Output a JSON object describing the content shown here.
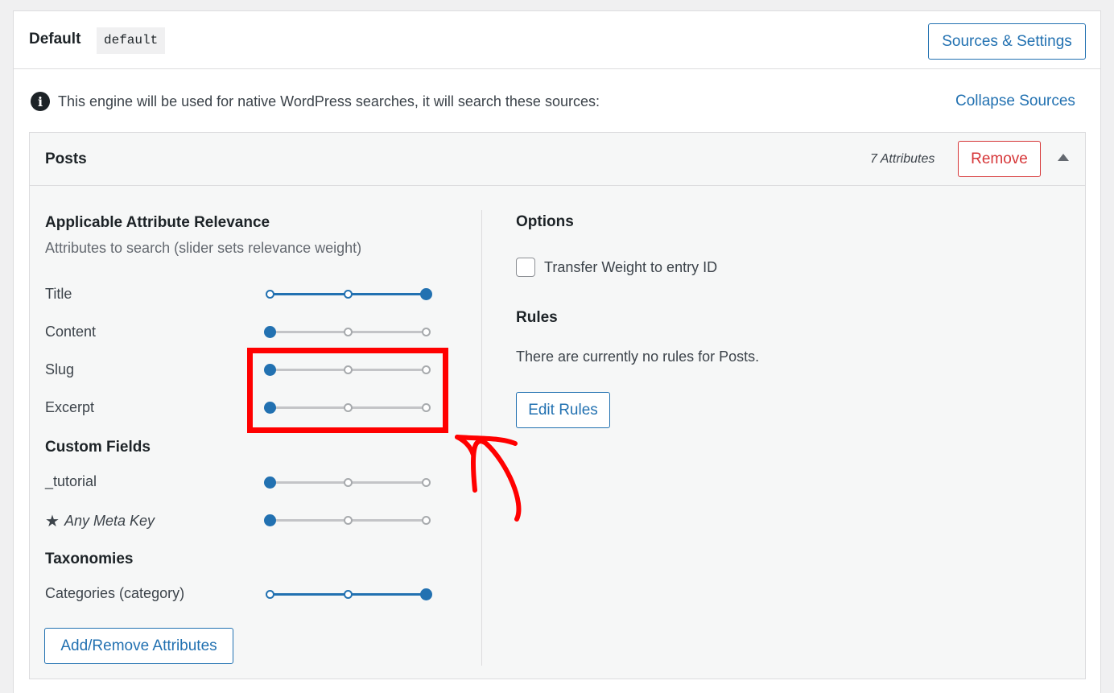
{
  "engine": {
    "title": "Default",
    "slug": "default",
    "sources_settings_label": "Sources & Settings"
  },
  "notice": {
    "icon": "info-icon",
    "text": "This engine will be used for native WordPress searches, it will search these sources:",
    "collapse_label": "Collapse Sources"
  },
  "source": {
    "title": "Posts",
    "attribute_count": "7 Attributes",
    "remove_label": "Remove",
    "toggle_icon": "triangle-up-icon"
  },
  "relevance": {
    "heading": "Applicable Attribute Relevance",
    "subheading": "Attributes to search (slider sets relevance weight)",
    "attributes": [
      {
        "label": "Title",
        "weight": 3
      },
      {
        "label": "Content",
        "weight": 1
      },
      {
        "label": "Slug",
        "weight": 1
      },
      {
        "label": "Excerpt",
        "weight": 1
      }
    ],
    "custom_fields_heading": "Custom Fields",
    "custom_fields": [
      {
        "label": "_tutorial",
        "weight": 1
      },
      {
        "label": "Any Meta Key",
        "weight": 1,
        "icon": "star-icon"
      }
    ],
    "taxonomies_heading": "Taxonomies",
    "taxonomies": [
      {
        "label": "Categories (category)",
        "weight": 3
      }
    ],
    "add_remove_label": "Add/Remove Attributes",
    "slider_max": 3
  },
  "options": {
    "heading": "Options",
    "transfer_weight_label": "Transfer Weight to entry ID",
    "transfer_weight_checked": false
  },
  "rules": {
    "heading": "Rules",
    "empty_text": "There are currently no rules for Posts.",
    "edit_label": "Edit Rules"
  },
  "colors": {
    "accent": "#2271b1",
    "danger": "#d63638",
    "annotation": "#ff0000"
  }
}
